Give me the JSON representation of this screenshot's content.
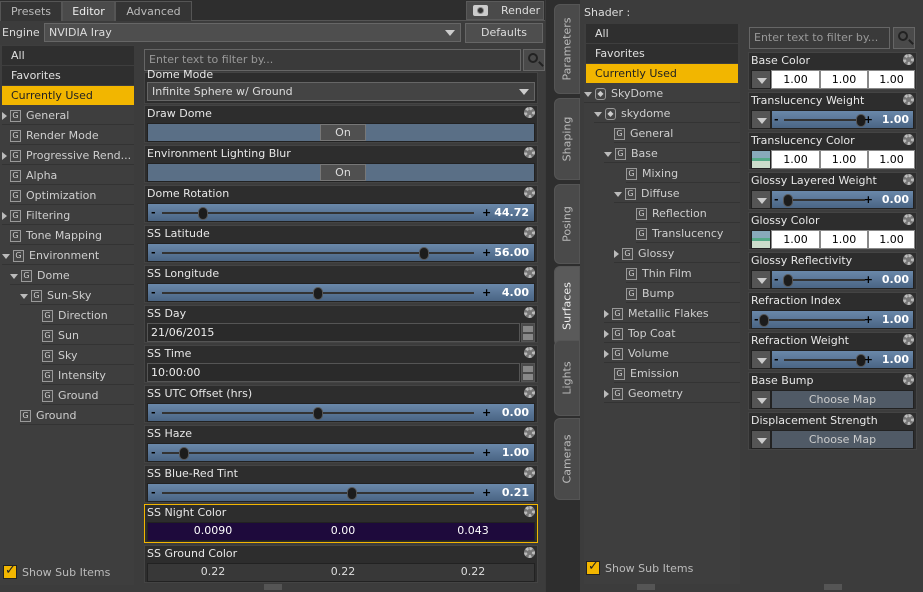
{
  "tabs": [
    {
      "label": "Presets"
    },
    {
      "label": "Editor"
    },
    {
      "label": "Advanced"
    }
  ],
  "render_label": "Render",
  "engine_label": "Engine :",
  "engine_value": "NVIDIA Iray",
  "defaults_label": "Defaults",
  "left_filter_placeholder": "Enter text to filter by...",
  "left_tree": {
    "cats": [
      "All",
      "Favorites",
      "Currently Used"
    ],
    "nodes": [
      "General",
      "Render Mode",
      "Progressive Rend...",
      "Alpha",
      "Optimization",
      "Filtering",
      "Tone Mapping",
      "Environment",
      "Dome",
      "Sun-Sky",
      "Direction",
      "Sun",
      "Sky",
      "Intensity",
      "Ground",
      "Ground"
    ]
  },
  "show_sub_items": "Show Sub Items",
  "props": {
    "dome_mode_label": "Dome Mode",
    "dome_mode_value": "Infinite Sphere w/ Ground",
    "draw_dome_label": "Draw Dome",
    "draw_dome_value": "On",
    "env_blur_label": "Environment Lighting Blur",
    "env_blur_value": "On",
    "dome_rotation_label": "Dome Rotation",
    "dome_rotation_value": "44.72",
    "ss_latitude_label": "SS Latitude",
    "ss_latitude_value": "56.00",
    "ss_longitude_label": "SS Longitude",
    "ss_longitude_value": "4.00",
    "ss_day_label": "SS Day",
    "ss_day_value": "21/06/2015",
    "ss_time_label": "SS Time",
    "ss_time_value": "10:00:00",
    "ss_utc_label": "SS UTC Offset (hrs)",
    "ss_utc_value": "0.00",
    "ss_haze_label": "SS Haze",
    "ss_haze_value": "1.00",
    "ss_tint_label": "SS Blue-Red Tint",
    "ss_tint_value": "0.21",
    "ss_night_label": "SS Night Color",
    "ss_night_values": [
      "0.0090",
      "0.00",
      "0.043"
    ],
    "ss_ground_label": "SS Ground Color",
    "ss_ground_values": [
      "0.22",
      "0.22",
      "0.22"
    ]
  },
  "vtabs": [
    "Parameters",
    "Shaping",
    "Posing",
    "Surfaces",
    "Lights",
    "Cameras"
  ],
  "shader_label": "Shader :",
  "right_filter_placeholder": "Enter text to filter by...",
  "right_tree": {
    "cats": [
      "All",
      "Favorites",
      "Currently Used"
    ],
    "nodes": [
      "SkyDome",
      "skydome",
      "General",
      "Base",
      "Mixing",
      "Diffuse",
      "Reflection",
      "Translucency",
      "Glossy",
      "Thin Film",
      "Bump",
      "Metallic Flakes",
      "Top Coat",
      "Volume",
      "Emission",
      "Geometry"
    ]
  },
  "rprops": {
    "base_color_label": "Base Color",
    "base_color": [
      "1.00",
      "1.00",
      "1.00"
    ],
    "trans_weight_label": "Translucency Weight",
    "trans_weight": "1.00",
    "trans_color_label": "Translucency Color",
    "trans_color": [
      "1.00",
      "1.00",
      "1.00"
    ],
    "glossy_layered_label": "Glossy Layered Weight",
    "glossy_layered": "0.00",
    "glossy_color_label": "Glossy Color",
    "glossy_color": [
      "1.00",
      "1.00",
      "1.00"
    ],
    "glossy_refl_label": "Glossy Reflectivity",
    "glossy_refl": "0.00",
    "refr_index_label": "Refraction Index",
    "refr_index": "1.00",
    "refr_weight_label": "Refraction Weight",
    "refr_weight": "1.00",
    "base_bump_label": "Base Bump",
    "base_bump": "Choose Map",
    "disp_label": "Displacement Strength",
    "disp": "Choose Map"
  },
  "slider_levels": {
    "dome_rotation": 0.13,
    "ss_latitude": 0.84,
    "ss_longitude": 0.5,
    "ss_utc": 0.5,
    "ss_haze": 0.07,
    "ss_tint": 0.61,
    "trans_weight": 0.95,
    "glossy_layered": 0.05,
    "glossy_refl": 0.05,
    "refr_index": 0.0,
    "refr_weight": 0.95
  },
  "colors": {
    "accent": "#f2b600",
    "night": "#1e0a3c",
    "slider": "#5a78a0"
  }
}
